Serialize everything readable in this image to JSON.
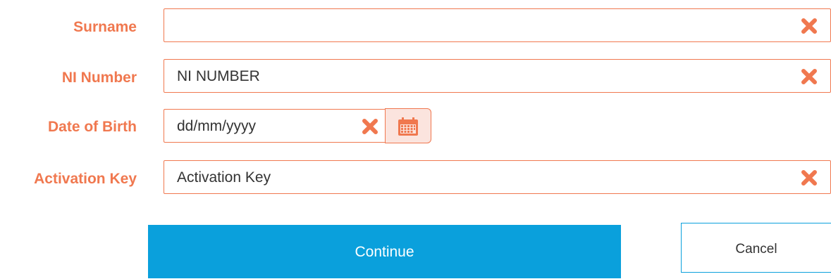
{
  "form": {
    "surname": {
      "label": "Surname",
      "value": ""
    },
    "ni_number": {
      "label": "NI Number",
      "value": "NI NUMBER"
    },
    "date_of_birth": {
      "label": "Date of Birth",
      "value": "dd/mm/yyyy"
    },
    "activation_key": {
      "label": "Activation Key",
      "value": "Activation Key"
    }
  },
  "buttons": {
    "continue": "Continue",
    "cancel": "Cancel"
  },
  "icons": {
    "clear": "close-icon",
    "calendar": "calendar-icon"
  },
  "colors": {
    "label": "#f0784f",
    "primary": "#0aa0dc",
    "calendar_bg": "#fbe4de"
  }
}
